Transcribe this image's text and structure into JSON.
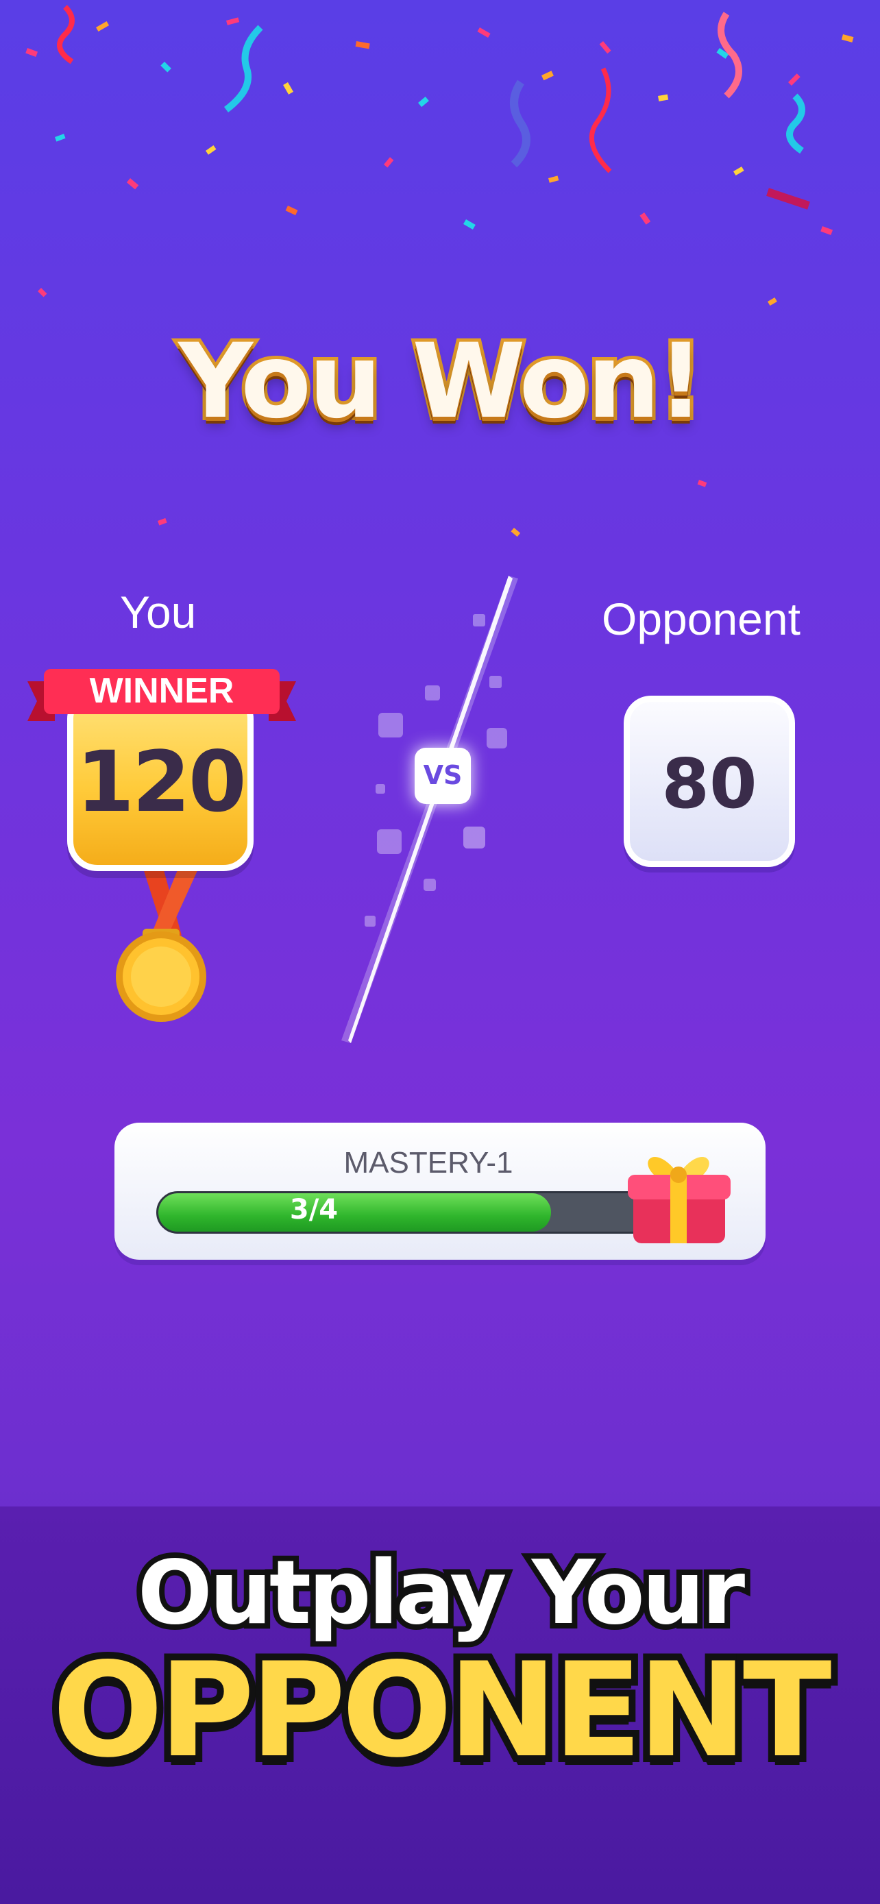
{
  "header": {
    "title": "You Won!"
  },
  "players": {
    "you": {
      "label": "You",
      "badge": "WINNER",
      "score": "120"
    },
    "opponent": {
      "label": "Opponent",
      "score": "80"
    },
    "vs_label": "VS"
  },
  "mastery": {
    "title": "MASTERY-1",
    "progress_text": "3/4",
    "progress_fraction": 0.75
  },
  "tagline": {
    "line1": "Outplay Your",
    "line2": "OPPONENT"
  },
  "colors": {
    "accent_yellow": "#ffd84a",
    "progress_green": "#2fb52c",
    "bg_purple": "#6a36e0"
  },
  "icons": {
    "medal": "gold-medal-icon",
    "gift": "gift-box-icon"
  }
}
